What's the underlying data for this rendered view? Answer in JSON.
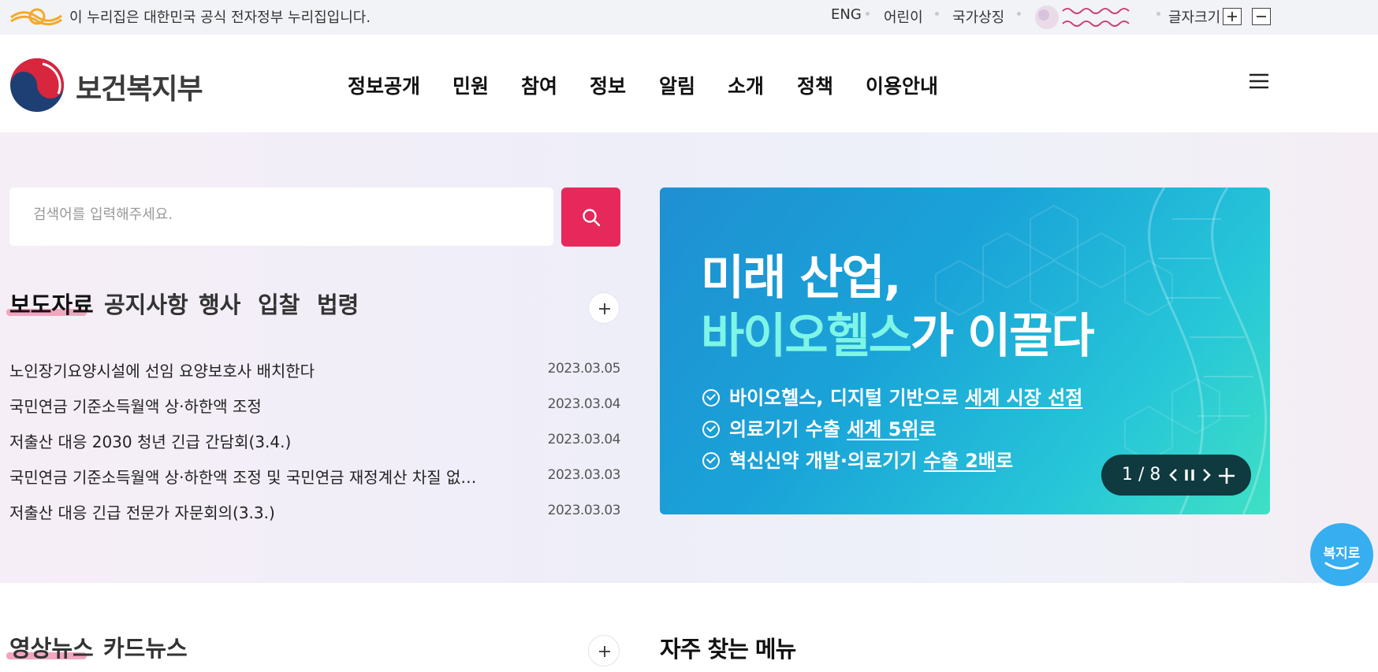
{
  "gov_banner": {
    "text": "이 누리집은 대한민국 공식 전자정부 누리집입니다.",
    "links": [
      "ENG",
      "어린이",
      "국가상징"
    ],
    "font_size_label": "글자크기"
  },
  "header": {
    "ministry_name": "보건복지부",
    "nav": [
      "정보공개",
      "민원",
      "참여",
      "정보",
      "알림",
      "소개",
      "정책",
      "이용안내"
    ]
  },
  "search": {
    "placeholder": "검색어를 입력해주세요."
  },
  "board": {
    "tabs": [
      "보도자료",
      "공지사항",
      "행사",
      "입찰",
      "법령"
    ],
    "active_tab": "보도자료",
    "items": [
      {
        "title": "노인장기요양시설에 선임 요양보호사 배치한다",
        "date": "2023.03.05"
      },
      {
        "title": "국민연금 기준소득월액 상·하한액 조정",
        "date": "2023.03.04"
      },
      {
        "title": "저출산 대응 2030 청년 긴급 간담회(3.4.)",
        "date": "2023.03.04"
      },
      {
        "title": "국민연금 기준소득월액 상·하한액 조정 및 국민연금 재정계산 차질 없이 진행",
        "date": "2023.03.03"
      },
      {
        "title": "저출산 대응 긴급 전문가 자문회의(3.3.)",
        "date": "2023.03.03"
      }
    ]
  },
  "banner": {
    "line1": "미래 산업,",
    "line2_highlight": "바이오헬스",
    "line2_rest": "가 이끌다",
    "bullets": [
      {
        "pre": "바이오헬스, 디지털 기반으로 ",
        "em": "세계 시장 선점",
        "post": ""
      },
      {
        "pre": "의료기기 수출 ",
        "em": "세계 5위",
        "post": "로"
      },
      {
        "pre": "혁신신약 개발·의료기기 ",
        "em": "수출 2배",
        "post": "로"
      }
    ],
    "slide_counter": "1 / 8"
  },
  "floating": {
    "bokjiro_label": "복지로"
  },
  "media": {
    "tabs": [
      "영상뉴스",
      "카드뉴스"
    ],
    "active_tab": "영상뉴스"
  },
  "quick_menu": {
    "title": "자주 찾는 메뉴"
  },
  "colors": {
    "accent_red": "#e6295a",
    "tab_underline": "#f3a6c0",
    "banner_dark": "#0f3a3f",
    "bokjiro_blue": "#36aef0"
  }
}
